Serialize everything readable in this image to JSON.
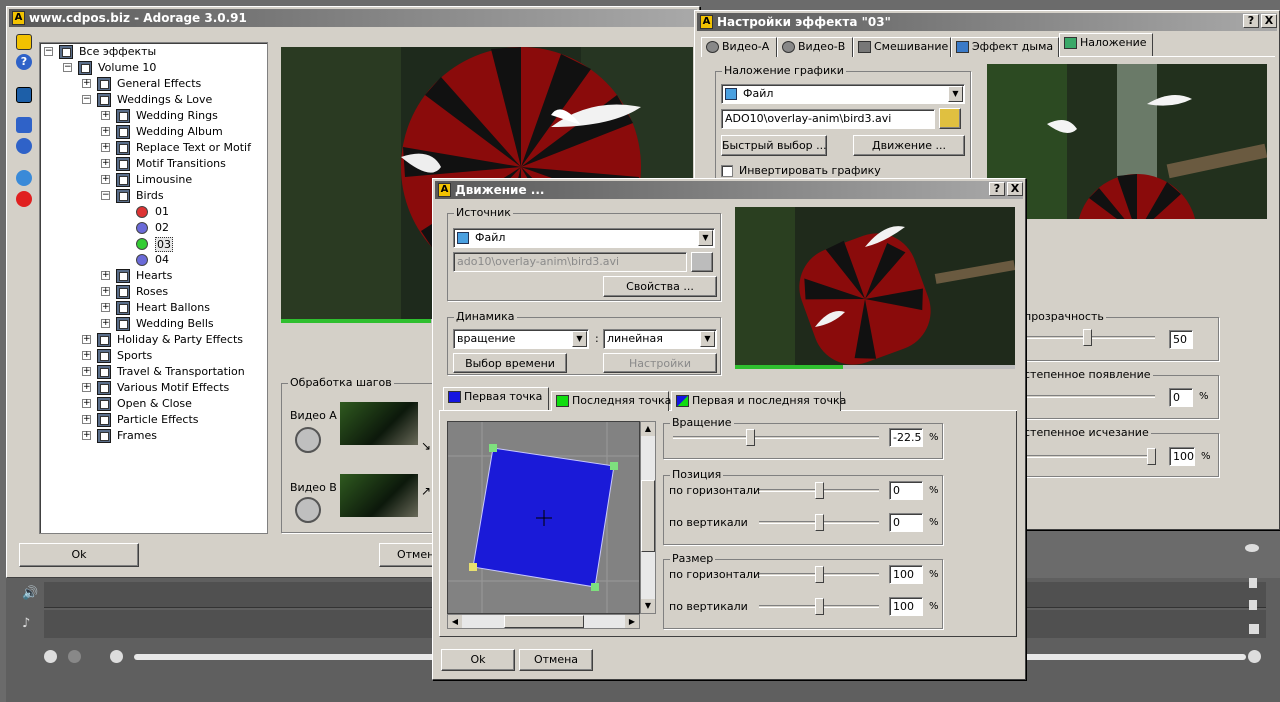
{
  "main_window": {
    "title": "www.cdpos.biz - Adorage 3.0.91",
    "tree": {
      "root": "Все эффекты",
      "volume": "Volume 10",
      "items": [
        {
          "label": "General Effects",
          "level": 2,
          "expanded": false
        },
        {
          "label": "Weddings & Love",
          "level": 2,
          "expanded": true
        },
        {
          "label": "Wedding Rings",
          "level": 3,
          "expanded": false
        },
        {
          "label": "Wedding Album",
          "level": 3,
          "expanded": false
        },
        {
          "label": "Replace Text or Motif",
          "level": 3,
          "expanded": false
        },
        {
          "label": "Motif Transitions",
          "level": 3,
          "expanded": false
        },
        {
          "label": "Limousine",
          "level": 3,
          "expanded": false
        },
        {
          "label": "Birds",
          "level": 3,
          "expanded": true
        },
        {
          "label": "01",
          "level": 4,
          "kind": "effect",
          "color": "#d33"
        },
        {
          "label": "02",
          "level": 4,
          "kind": "effect",
          "color": "#6a6ad8"
        },
        {
          "label": "03",
          "level": 4,
          "kind": "effect",
          "color": "#3c3",
          "selected": true
        },
        {
          "label": "04",
          "level": 4,
          "kind": "effect",
          "color": "#6a6ad8"
        },
        {
          "label": "Hearts",
          "level": 3,
          "expanded": false
        },
        {
          "label": "Roses",
          "level": 3,
          "expanded": false
        },
        {
          "label": "Heart Ballons",
          "level": 3,
          "expanded": false
        },
        {
          "label": "Wedding Bells",
          "level": 3,
          "expanded": false
        },
        {
          "label": "Holiday & Party Effects",
          "level": 2,
          "expanded": false
        },
        {
          "label": "Sports",
          "level": 2,
          "expanded": false
        },
        {
          "label": "Travel & Transportation",
          "level": 2,
          "expanded": false
        },
        {
          "label": "Various Motif Effects",
          "level": 2,
          "expanded": false
        },
        {
          "label": "Open & Close",
          "level": 2,
          "expanded": false
        },
        {
          "label": "Particle Effects",
          "level": 2,
          "expanded": false
        },
        {
          "label": "Frames",
          "level": 2,
          "expanded": false
        }
      ]
    },
    "steps_group": "Обработка шагов",
    "video_a": "Видео A",
    "video_b": "Видео B",
    "ok": "Ok",
    "cancel": "Отмена"
  },
  "settings_window": {
    "title": "Настройки эффекта \"03\"",
    "help": "?",
    "close": "X",
    "tabs": [
      "Видео-A",
      "Видео-B",
      "Смешивание",
      "Эффект дыма",
      "Наложение"
    ],
    "active_tab": 4,
    "overlay_group": "Наложение графики",
    "source_select": "Файл",
    "file_path": "ADO10\\overlay-anim\\bird3.avi",
    "quick_select": "Быстрый выбор ...",
    "motion": "Движение ...",
    "invert": "Инвертировать графику",
    "transparency": {
      "label": "прозрачность",
      "value": "50",
      "level": 0.5
    },
    "fade_in": {
      "label": "степенное появление",
      "value": "0",
      "level": 0.0
    },
    "fade_out": {
      "label": "степенное исчезание",
      "value": "100",
      "level": 1.0
    }
  },
  "motion_dialog": {
    "title": "Движение ...",
    "help": "?",
    "close": "X",
    "source_group": "Источник",
    "source_select": "Файл",
    "file_path": "ado10\\overlay-anim\\bird3.avi",
    "properties": "Свойства ...",
    "dynamics_group": "Динамика",
    "dynamics_type": "вращение",
    "dynamics_mode": "линейная",
    "time_select": "Выбор времени",
    "settings": "Настройки",
    "tabs": [
      {
        "label": "Первая точка",
        "color": "#1515e0"
      },
      {
        "label": "Последняя точка",
        "color": "#10dd10"
      },
      {
        "label": "Первая и последняя точка",
        "color": "#1515e0"
      }
    ],
    "rotation_group": "Вращение",
    "rotation": {
      "value": "-22.5",
      "level": 0.375
    },
    "position_group": "Позиция",
    "pos_h": {
      "label": "по горизонтали",
      "value": "0",
      "level": 0.5
    },
    "pos_v": {
      "label": "по вертикали",
      "value": "0",
      "level": 0.5
    },
    "size_group": "Размер",
    "size_h": {
      "label": "по горизонтали",
      "value": "100",
      "level": 0.5
    },
    "size_v": {
      "label": "по вертикали",
      "value": "100",
      "level": 0.5
    },
    "percent": "%",
    "ok": "Ok",
    "cancel": "Отмена"
  },
  "colors": {
    "shape": "#1a1ad8",
    "handle": "#7ee07e",
    "handle_yellow": "#e8e070"
  }
}
